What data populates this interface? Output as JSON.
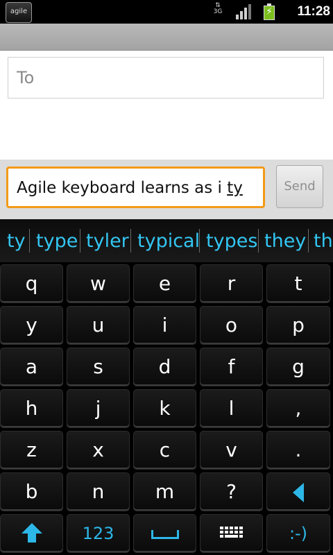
{
  "status_bar": {
    "app_badge": "agile",
    "network": "3G",
    "time": "11:28",
    "battery_color": "#7bbf1e"
  },
  "compose": {
    "to_placeholder": "To",
    "message_text": "Agile keyboard learns as i ",
    "message_composing": "ty",
    "send_label": "Send",
    "focus_color": "#f39a18"
  },
  "suggestions": [
    "ty",
    "type",
    "tyler",
    "typical",
    "types",
    "they",
    "the"
  ],
  "suggestion_color": "#33c6f2",
  "keyboard": {
    "rows": [
      [
        "q",
        "w",
        "e",
        "r",
        "t"
      ],
      [
        "y",
        "u",
        "i",
        "o",
        "p"
      ],
      [
        "a",
        "s",
        "d",
        "f",
        "g"
      ],
      [
        "h",
        "j",
        "k",
        "l",
        ","
      ],
      [
        "z",
        "x",
        "c",
        "v",
        "."
      ],
      [
        "b",
        "n",
        "m",
        "?"
      ]
    ],
    "backspace_icon": "backspace-left-triangle-icon",
    "shift_icon": "shift-up-arrow-icon",
    "numbers_label": "123",
    "space_icon": "space-bar-icon",
    "keyboard_switch_icon": "keyboard-icon",
    "emoticon_label": ":-)",
    "accent_color": "#2db7e8"
  }
}
